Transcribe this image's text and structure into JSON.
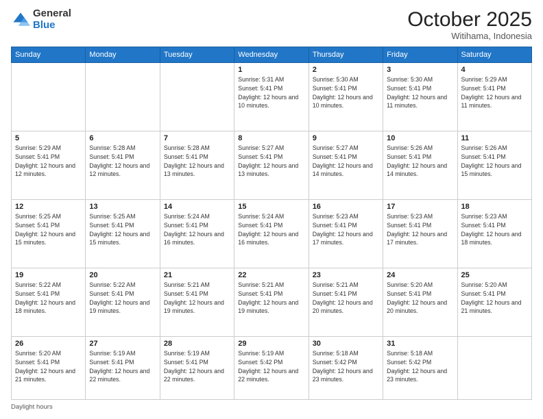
{
  "logo": {
    "general": "General",
    "blue": "Blue"
  },
  "header": {
    "month": "October 2025",
    "location": "Witihama, Indonesia"
  },
  "weekdays": [
    "Sunday",
    "Monday",
    "Tuesday",
    "Wednesday",
    "Thursday",
    "Friday",
    "Saturday"
  ],
  "footer": {
    "daylight_label": "Daylight hours"
  },
  "weeks": [
    [
      {
        "day": "",
        "info": ""
      },
      {
        "day": "",
        "info": ""
      },
      {
        "day": "",
        "info": ""
      },
      {
        "day": "1",
        "info": "Sunrise: 5:31 AM\nSunset: 5:41 PM\nDaylight: 12 hours\nand 10 minutes."
      },
      {
        "day": "2",
        "info": "Sunrise: 5:30 AM\nSunset: 5:41 PM\nDaylight: 12 hours\nand 10 minutes."
      },
      {
        "day": "3",
        "info": "Sunrise: 5:30 AM\nSunset: 5:41 PM\nDaylight: 12 hours\nand 11 minutes."
      },
      {
        "day": "4",
        "info": "Sunrise: 5:29 AM\nSunset: 5:41 PM\nDaylight: 12 hours\nand 11 minutes."
      }
    ],
    [
      {
        "day": "5",
        "info": "Sunrise: 5:29 AM\nSunset: 5:41 PM\nDaylight: 12 hours\nand 12 minutes."
      },
      {
        "day": "6",
        "info": "Sunrise: 5:28 AM\nSunset: 5:41 PM\nDaylight: 12 hours\nand 12 minutes."
      },
      {
        "day": "7",
        "info": "Sunrise: 5:28 AM\nSunset: 5:41 PM\nDaylight: 12 hours\nand 13 minutes."
      },
      {
        "day": "8",
        "info": "Sunrise: 5:27 AM\nSunset: 5:41 PM\nDaylight: 12 hours\nand 13 minutes."
      },
      {
        "day": "9",
        "info": "Sunrise: 5:27 AM\nSunset: 5:41 PM\nDaylight: 12 hours\nand 14 minutes."
      },
      {
        "day": "10",
        "info": "Sunrise: 5:26 AM\nSunset: 5:41 PM\nDaylight: 12 hours\nand 14 minutes."
      },
      {
        "day": "11",
        "info": "Sunrise: 5:26 AM\nSunset: 5:41 PM\nDaylight: 12 hours\nand 15 minutes."
      }
    ],
    [
      {
        "day": "12",
        "info": "Sunrise: 5:25 AM\nSunset: 5:41 PM\nDaylight: 12 hours\nand 15 minutes."
      },
      {
        "day": "13",
        "info": "Sunrise: 5:25 AM\nSunset: 5:41 PM\nDaylight: 12 hours\nand 15 minutes."
      },
      {
        "day": "14",
        "info": "Sunrise: 5:24 AM\nSunset: 5:41 PM\nDaylight: 12 hours\nand 16 minutes."
      },
      {
        "day": "15",
        "info": "Sunrise: 5:24 AM\nSunset: 5:41 PM\nDaylight: 12 hours\nand 16 minutes."
      },
      {
        "day": "16",
        "info": "Sunrise: 5:23 AM\nSunset: 5:41 PM\nDaylight: 12 hours\nand 17 minutes."
      },
      {
        "day": "17",
        "info": "Sunrise: 5:23 AM\nSunset: 5:41 PM\nDaylight: 12 hours\nand 17 minutes."
      },
      {
        "day": "18",
        "info": "Sunrise: 5:23 AM\nSunset: 5:41 PM\nDaylight: 12 hours\nand 18 minutes."
      }
    ],
    [
      {
        "day": "19",
        "info": "Sunrise: 5:22 AM\nSunset: 5:41 PM\nDaylight: 12 hours\nand 18 minutes."
      },
      {
        "day": "20",
        "info": "Sunrise: 5:22 AM\nSunset: 5:41 PM\nDaylight: 12 hours\nand 19 minutes."
      },
      {
        "day": "21",
        "info": "Sunrise: 5:21 AM\nSunset: 5:41 PM\nDaylight: 12 hours\nand 19 minutes."
      },
      {
        "day": "22",
        "info": "Sunrise: 5:21 AM\nSunset: 5:41 PM\nDaylight: 12 hours\nand 19 minutes."
      },
      {
        "day": "23",
        "info": "Sunrise: 5:21 AM\nSunset: 5:41 PM\nDaylight: 12 hours\nand 20 minutes."
      },
      {
        "day": "24",
        "info": "Sunrise: 5:20 AM\nSunset: 5:41 PM\nDaylight: 12 hours\nand 20 minutes."
      },
      {
        "day": "25",
        "info": "Sunrise: 5:20 AM\nSunset: 5:41 PM\nDaylight: 12 hours\nand 21 minutes."
      }
    ],
    [
      {
        "day": "26",
        "info": "Sunrise: 5:20 AM\nSunset: 5:41 PM\nDaylight: 12 hours\nand 21 minutes."
      },
      {
        "day": "27",
        "info": "Sunrise: 5:19 AM\nSunset: 5:41 PM\nDaylight: 12 hours\nand 22 minutes."
      },
      {
        "day": "28",
        "info": "Sunrise: 5:19 AM\nSunset: 5:41 PM\nDaylight: 12 hours\nand 22 minutes."
      },
      {
        "day": "29",
        "info": "Sunrise: 5:19 AM\nSunset: 5:42 PM\nDaylight: 12 hours\nand 22 minutes."
      },
      {
        "day": "30",
        "info": "Sunrise: 5:18 AM\nSunset: 5:42 PM\nDaylight: 12 hours\nand 23 minutes."
      },
      {
        "day": "31",
        "info": "Sunrise: 5:18 AM\nSunset: 5:42 PM\nDaylight: 12 hours\nand 23 minutes."
      },
      {
        "day": "",
        "info": ""
      }
    ]
  ]
}
